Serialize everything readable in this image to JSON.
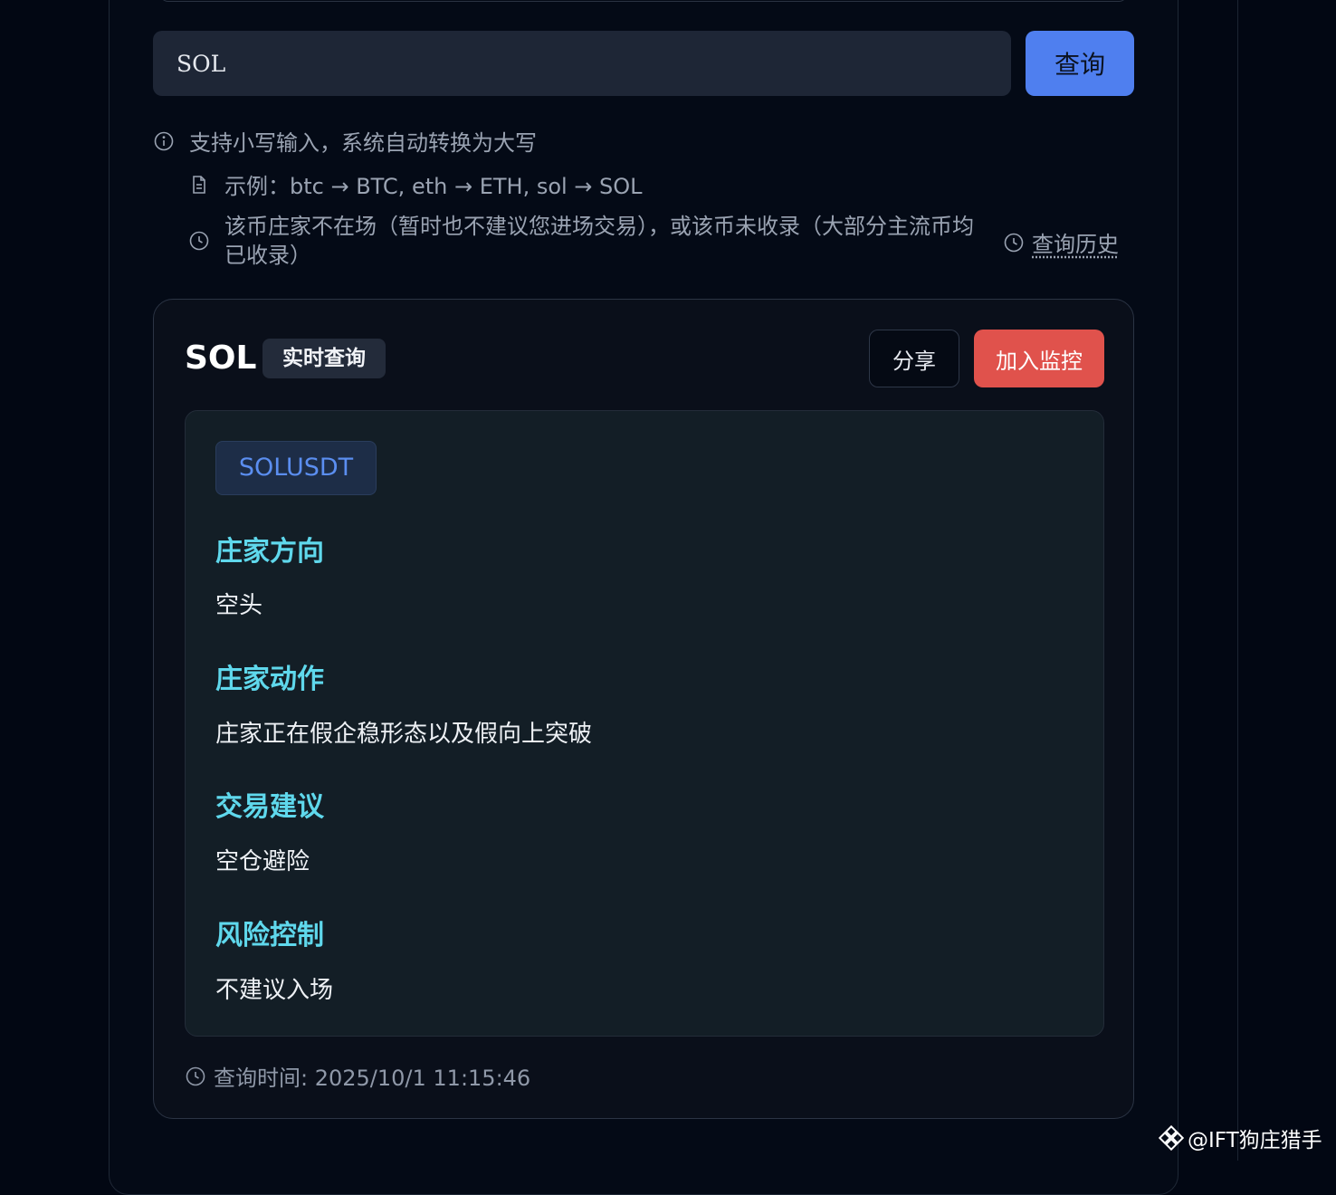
{
  "search": {
    "value": "SOL",
    "button_label": "查询"
  },
  "hints": {
    "lowercase": "支持小写输入，系统自动转换为大写",
    "example": "示例：btc → BTC, eth → ETH, sol → SOL",
    "not_listed": "该币庄家不在场（暂时也不建议您进场交易），或该币未收录（大部分主流币均已收录）",
    "history_label": "查询历史"
  },
  "result": {
    "coin": "SOL",
    "badge": "实时查询",
    "share_label": "分享",
    "monitor_label": "加入监控",
    "pair": "SOLUSDT",
    "sections": [
      {
        "title": "庄家方向",
        "value": "空头"
      },
      {
        "title": "庄家动作",
        "value": "庄家正在假企稳形态以及假向上突破"
      },
      {
        "title": "交易建议",
        "value": "空仓避险"
      },
      {
        "title": "风险控制",
        "value": "不建议入场"
      }
    ],
    "query_time": "查询时间: 2025/10/1 11:15:46"
  },
  "watermark": "@IFT狗庄猎手",
  "icons": {
    "info": "info-circle-icon",
    "example": "document-icon",
    "clock": "clock-icon",
    "history": "clock-icon",
    "watermark": "diamond-logo-icon"
  },
  "colors": {
    "accent_blue": "#4f7fef",
    "danger_red": "#e0524c",
    "section_cyan": "#5fd8ec"
  }
}
